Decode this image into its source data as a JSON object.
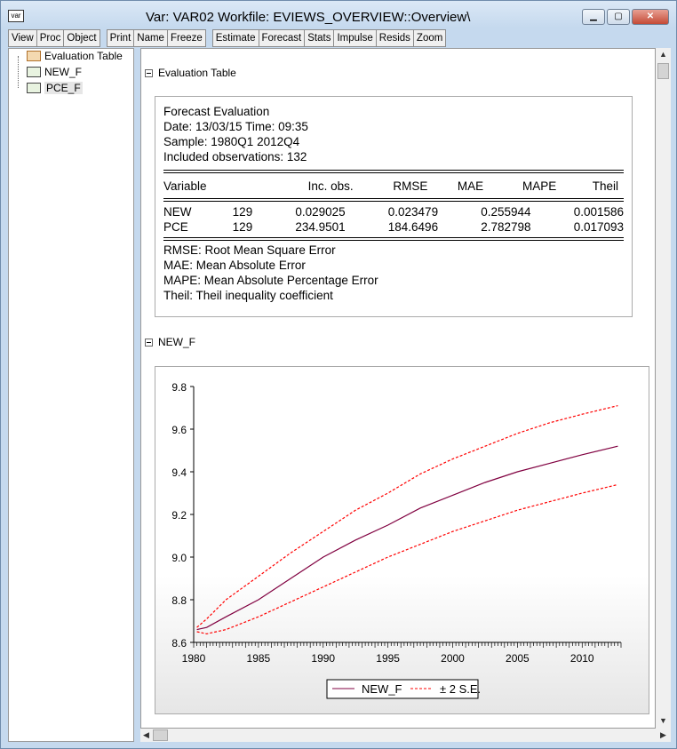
{
  "window": {
    "icon_label": "var",
    "title": "Var: VAR02    Workfile: EVIEWS_OVERVIEW::Overview\\",
    "controls": [
      "minimize",
      "maximize",
      "close"
    ]
  },
  "toolbar": {
    "group1": [
      "View",
      "Proc",
      "Object"
    ],
    "group2": [
      "Print",
      "Name",
      "Freeze"
    ],
    "group3": [
      "Estimate",
      "Forecast",
      "Stats",
      "Impulse",
      "Resids",
      "Zoom"
    ]
  },
  "tree": {
    "items": [
      {
        "label": "Evaluation Table",
        "icon": "table-icon"
      },
      {
        "label": "NEW_F",
        "icon": "graph-icon"
      },
      {
        "label": "PCE_F",
        "icon": "graph-icon",
        "selected": true
      }
    ]
  },
  "eval": {
    "section": "Evaluation Table",
    "title": "Forecast Evaluation",
    "date": "Date: 13/03/15   Time: 09:35",
    "sample": "Sample: 1980Q1 2012Q4",
    "obs": "Included observations: 132",
    "headers": [
      "Variable",
      "Inc. obs.",
      "RMSE",
      "MAE",
      "MAPE",
      "Theil"
    ],
    "rows": [
      [
        "NEW",
        "129",
        "0.029025",
        "0.023479",
        "0.255944",
        "0.001586"
      ],
      [
        "PCE",
        "129",
        "234.9501",
        "184.6496",
        "2.782798",
        "0.017093"
      ]
    ],
    "notes": [
      "RMSE:  Root Mean Square Error",
      "MAE:  Mean Absolute Error",
      "MAPE:  Mean Absolute Percentage Error",
      "Theil:  Theil inequality coefficient"
    ]
  },
  "graph_section": "NEW_F",
  "chart_data": {
    "type": "line",
    "title": "",
    "xlabel": "",
    "ylabel": "",
    "xlim": [
      1980,
      2013
    ],
    "ylim": [
      8.6,
      9.8
    ],
    "xticks": [
      "1980",
      "1985",
      "1990",
      "1995",
      "2000",
      "2005",
      "2010"
    ],
    "yticks": [
      "9.8",
      "9.6",
      "9.4",
      "9.2",
      "9.0",
      "8.8",
      "8.6"
    ],
    "legend": "bottom-center",
    "x": [
      1980.25,
      1981,
      1982.5,
      1985,
      1987.5,
      1990,
      1992.5,
      1995,
      1997.5,
      2000,
      2002.5,
      2005,
      2007.5,
      2010,
      2012.75
    ],
    "series": [
      {
        "name": "NEW_F",
        "color": "#800040",
        "style": "solid",
        "values": [
          8.66,
          8.67,
          8.72,
          8.8,
          8.9,
          9.0,
          9.08,
          9.15,
          9.23,
          9.29,
          9.35,
          9.4,
          9.44,
          9.48,
          9.52
        ]
      },
      {
        "name": "± 2 S.E.",
        "color": "#ff0000",
        "style": "dashed",
        "values": [
          8.67,
          8.71,
          8.8,
          8.91,
          9.02,
          9.12,
          9.22,
          9.3,
          9.39,
          9.46,
          9.52,
          9.58,
          9.63,
          9.67,
          9.71
        ]
      },
      {
        "name": "",
        "color": "#ff0000",
        "style": "dashed",
        "values": [
          8.65,
          8.64,
          8.66,
          8.72,
          8.79,
          8.86,
          8.93,
          9.0,
          9.06,
          9.12,
          9.17,
          9.22,
          9.26,
          9.3,
          9.34
        ]
      }
    ]
  }
}
